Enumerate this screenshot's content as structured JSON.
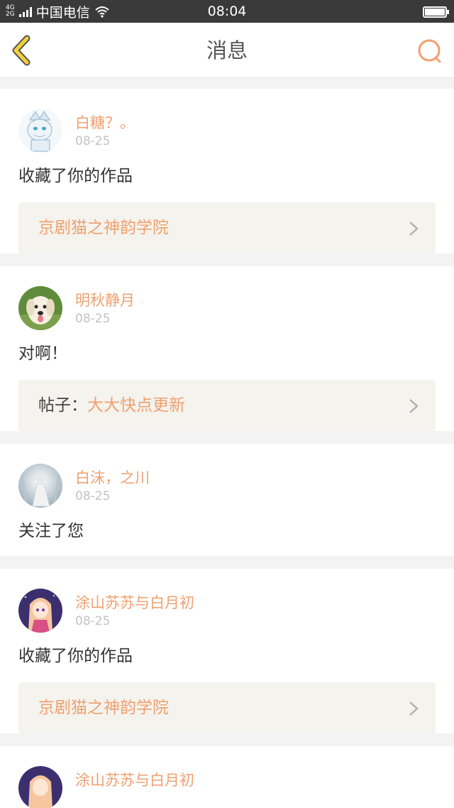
{
  "status_bar": {
    "network_top": "4G",
    "network_bottom": "2G",
    "carrier": "中国电信",
    "time": "08:04",
    "battery_level": 1.0
  },
  "nav": {
    "title": "消息",
    "back_icon": "chevron-left-icon",
    "search_icon": "search-icon"
  },
  "colors": {
    "accent": "#f0a070",
    "back_arrow": "#f2d13c",
    "link_bg": "#f4f3ed"
  },
  "messages": [
    {
      "user": "白糖？。",
      "date": "08-25",
      "text": "收藏了你的作品",
      "link_prefix": "",
      "link": "京剧猫之神韵学院"
    },
    {
      "user": "明秋静月",
      "date": "08-25",
      "text": "对啊！",
      "link_prefix": "帖子：",
      "link": "大大快点更新"
    },
    {
      "user": "白沫，之川",
      "date": "08-25",
      "text": "关注了您"
    },
    {
      "user": "涂山苏苏与白月初",
      "date": "08-25",
      "text": "收藏了你的作品",
      "link_prefix": "",
      "link": "京剧猫之神韵学院"
    },
    {
      "user": "涂山苏苏与白月初"
    }
  ]
}
